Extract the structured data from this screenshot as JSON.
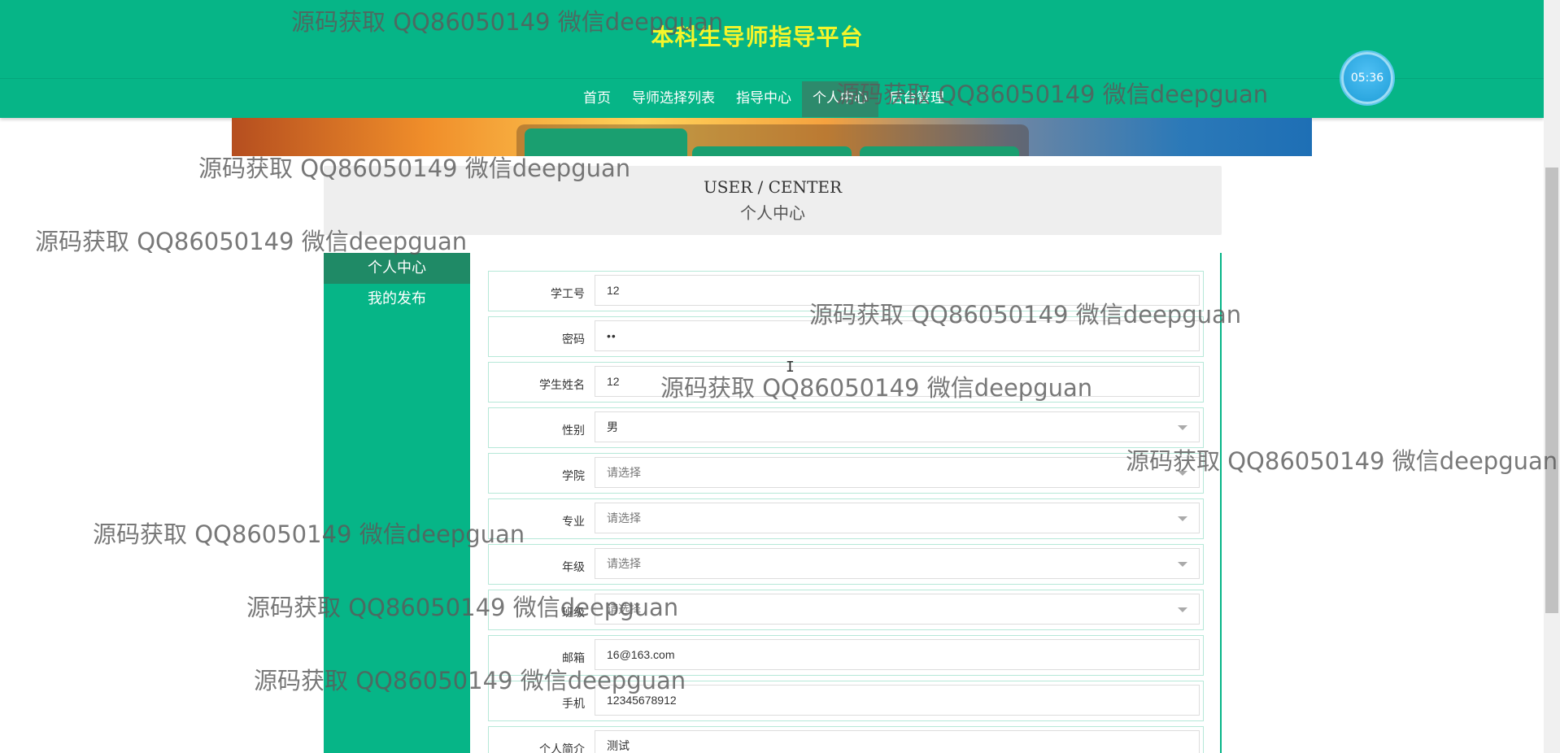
{
  "header": {
    "title": "本科生导师指导平台",
    "nav": [
      "首页",
      "导师选择列表",
      "指导中心",
      "个人中心",
      "后台管理"
    ],
    "active_nav": "个人中心",
    "clock": "05:36"
  },
  "page_title": {
    "en": "USER / CENTER",
    "cn": "个人中心"
  },
  "sidebar": {
    "items": [
      {
        "label": "个人中心"
      },
      {
        "label": "我的发布"
      }
    ]
  },
  "form": {
    "fields": [
      {
        "label": "学工号",
        "value": "12"
      },
      {
        "label": "密码",
        "value": "••"
      },
      {
        "label": "学生姓名",
        "value": "12"
      },
      {
        "label": "性别",
        "value": "男"
      },
      {
        "label": "学院",
        "value": "请选择"
      },
      {
        "label": "专业",
        "value": "请选择"
      },
      {
        "label": "年级",
        "value": "请选择"
      },
      {
        "label": "班级",
        "value": "请选择"
      },
      {
        "label": "邮箱",
        "value": "16@163.com"
      },
      {
        "label": "手机",
        "value": "12345678912"
      },
      {
        "label": "个人简介",
        "value": "测试"
      }
    ]
  },
  "watermark": {
    "text": "源码获取 QQ86050149 微信deepguan"
  },
  "colors": {
    "primary": "#06b587",
    "title_yellow": "#f5f52a",
    "active_nav": "#2d8a6c"
  }
}
